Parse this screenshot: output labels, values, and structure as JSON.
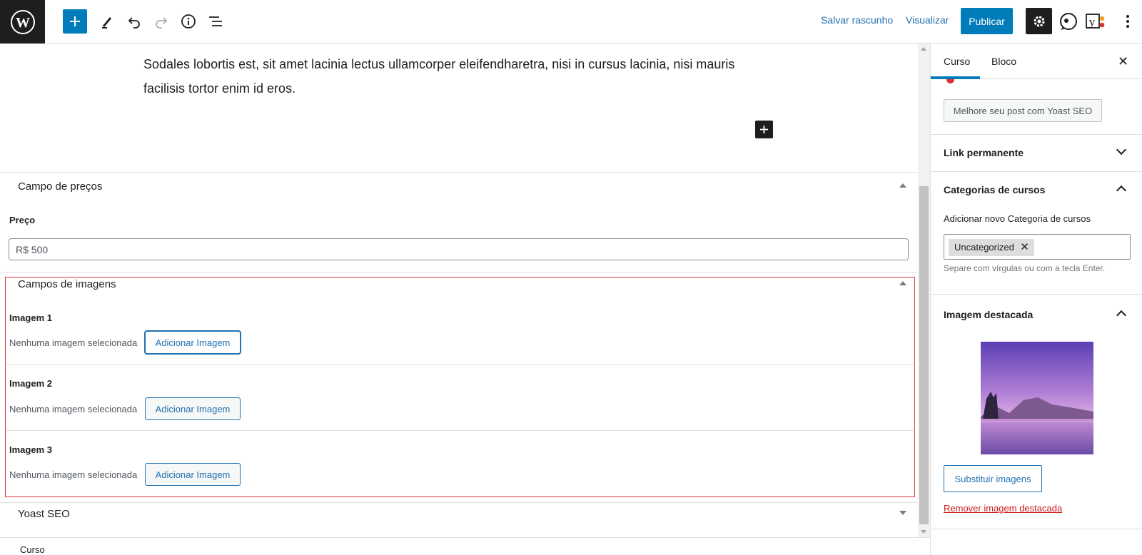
{
  "topbar": {
    "save_draft": "Salvar rascunho",
    "preview": "Visualizar",
    "publish": "Publicar"
  },
  "editor": {
    "paragraph": "Sodales lobortis est, sit amet lacinia lectus ullamcorper eleifendharetra, nisi in cursus lacinia, nisi mauris facilisis tortor enim id eros."
  },
  "price_box": {
    "title": "Campo de preços",
    "label": "Preço",
    "value": "R$ 500"
  },
  "images_box": {
    "title": "Campos de imagens",
    "items": [
      {
        "label": "Imagem 1",
        "status": "Nenhuma imagem selecionada",
        "button": "Adicionar Imagem"
      },
      {
        "label": "Imagem 2",
        "status": "Nenhuma imagem selecionada",
        "button": "Adicionar Imagem"
      },
      {
        "label": "Imagem 3",
        "status": "Nenhuma imagem selecionada",
        "button": "Adicionar Imagem"
      }
    ]
  },
  "yoast_box": {
    "title": "Yoast SEO"
  },
  "footer": {
    "breadcrumb": "Curso"
  },
  "sidebar": {
    "tabs": [
      "Curso",
      "Bloco"
    ],
    "yoast_button": "Melhore seu post com Yoast SEO",
    "permalink_title": "Link permanente",
    "categories": {
      "title": "Categorias de cursos",
      "add_label": "Adicionar novo Categoria de cursos",
      "token": "Uncategorized",
      "help": "Separe com vírgulas ou com a tecla Enter."
    },
    "featured": {
      "title": "Imagem destacada",
      "replace": "Substituir imagens",
      "remove": "Remover imagem destacada"
    }
  },
  "colors": {
    "accent": "#007cba",
    "highlight_border": "#d63638",
    "danger_link": "#cc1818"
  }
}
